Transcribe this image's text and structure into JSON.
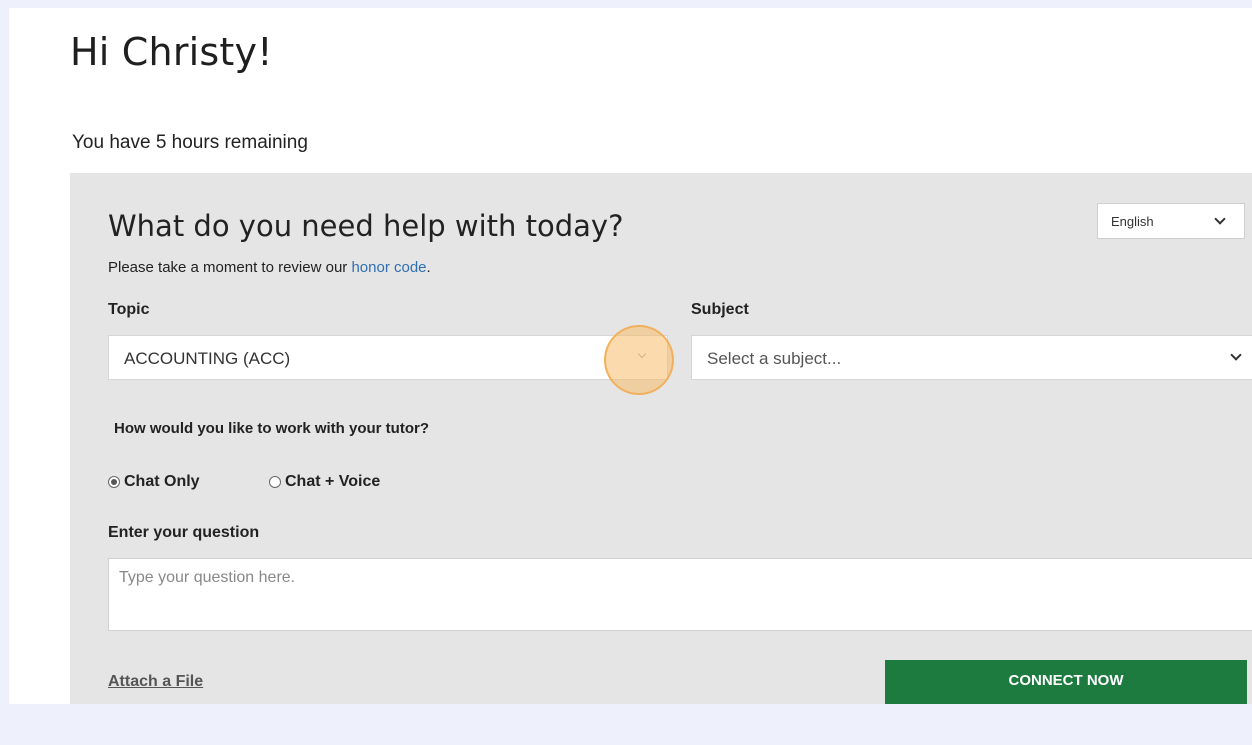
{
  "greeting": "Hi Christy!",
  "hours_remaining": "You have 5 hours remaining",
  "panel": {
    "title": "What do you need help with today?",
    "language": {
      "selected": "English"
    },
    "honor_prefix": "Please take a moment to review our ",
    "honor_link": "honor code",
    "honor_suffix": ".",
    "topic": {
      "label": "Topic",
      "selected": "ACCOUNTING (ACC)"
    },
    "subject": {
      "label": "Subject",
      "placeholder": "Select a subject..."
    },
    "work_question": "How would you like to work with your tutor?",
    "options": [
      {
        "label": "Chat Only",
        "checked": true
      },
      {
        "label": "Chat + Voice",
        "checked": false
      }
    ],
    "question": {
      "label": "Enter your question",
      "placeholder": "Type your question here."
    },
    "attach_label": "Attach a File",
    "connect_label": "CONNECT NOW"
  },
  "colors": {
    "page_background": "#eef0fb",
    "panel_background": "#e5e5e5",
    "link": "#2f6fb0",
    "connect_button": "#1e7b40",
    "click_marker": "#f7be69"
  }
}
